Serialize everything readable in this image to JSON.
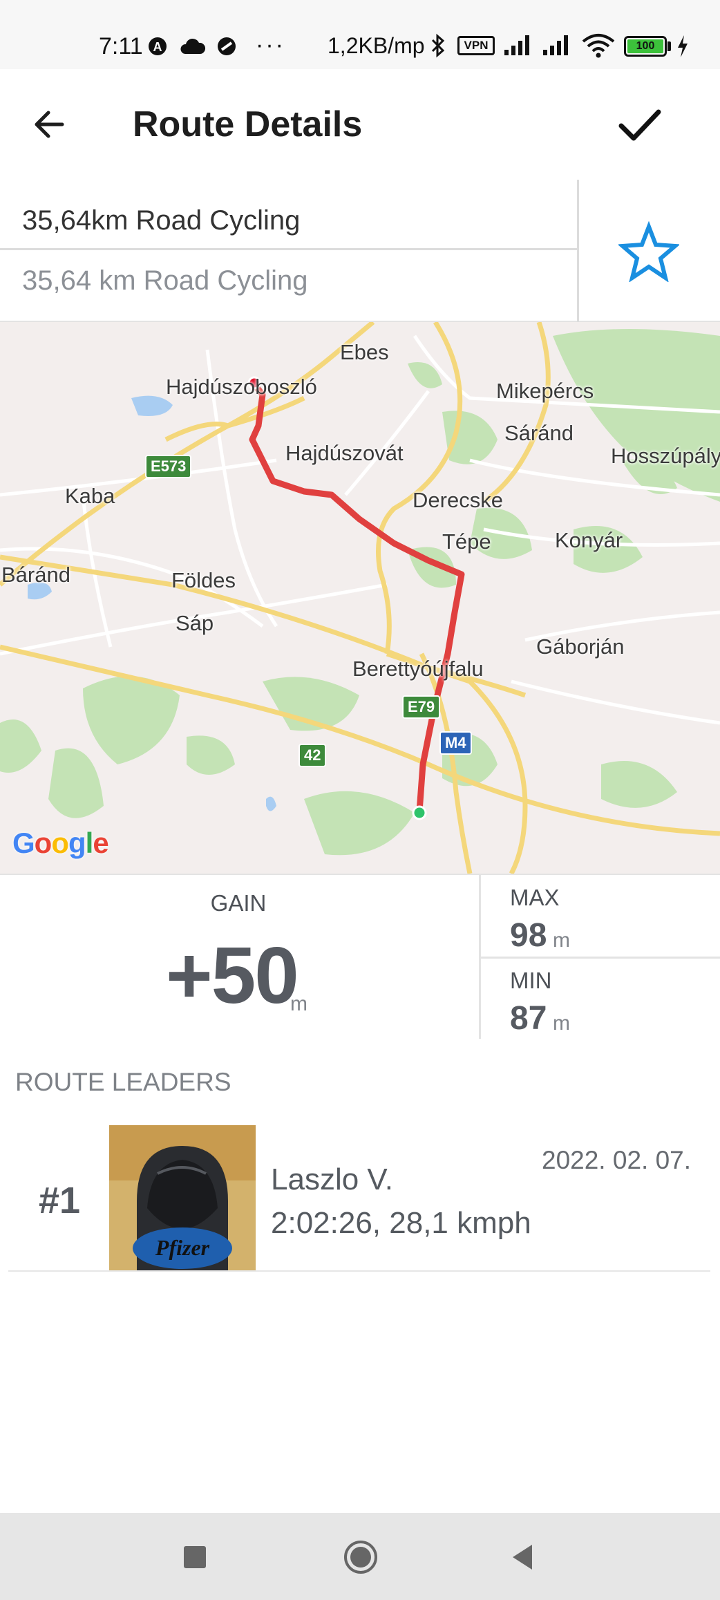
{
  "status_bar": {
    "time": "7:11",
    "net_speed": "1,2KB/mp",
    "vpn_label": "VPN",
    "battery_level": "100",
    "more": "···",
    "icons": [
      "a-circle-icon",
      "cloud-icon",
      "no-disturb-icon",
      "bluetooth-icon",
      "signal-icon",
      "signal-icon",
      "wifi-icon",
      "battery-icon",
      "charging-icon"
    ]
  },
  "app_bar": {
    "title": "Route Details",
    "back_icon": "arrow-left-icon",
    "confirm_icon": "check-icon"
  },
  "route": {
    "name_value": "35,64km Road Cycling",
    "name_hint": "35,64 km Road Cycling",
    "favorite_icon": "star-outline-icon",
    "accent_color": "#1a8fe0"
  },
  "map": {
    "places": [
      "Ebes",
      "Hajdúszoboszló",
      "Mikepércs",
      "Sáránd",
      "Hosszúpály",
      "Hajdúszovát",
      "Kaba",
      "Derecske",
      "Tépe",
      "Konyár",
      "Báránd",
      "Földes",
      "Sáp",
      "Gáborján",
      "Berettyóújfalu"
    ],
    "road_shields": [
      "E573",
      "E79",
      "M4",
      "42"
    ],
    "route_color": "#e0403f",
    "provider": "Google"
  },
  "elevation": {
    "gain_label": "GAIN",
    "gain_value": "+50",
    "gain_unit": "m",
    "max_label": "MAX",
    "max_value": "98",
    "max_unit": "m",
    "min_label": "MIN",
    "min_value": "87",
    "min_unit": "m"
  },
  "leaders": {
    "title": "ROUTE LEADERS",
    "rows": [
      {
        "rank": "#1",
        "name": "Laszlo V.",
        "stats": "2:02:26, 28,1 kmph",
        "date": "2022. 02. 07.",
        "avatar_text": "Pfizer"
      }
    ]
  },
  "nav_bar": {
    "icons": [
      "recents-square-icon",
      "home-circle-icon",
      "back-triangle-icon"
    ]
  }
}
